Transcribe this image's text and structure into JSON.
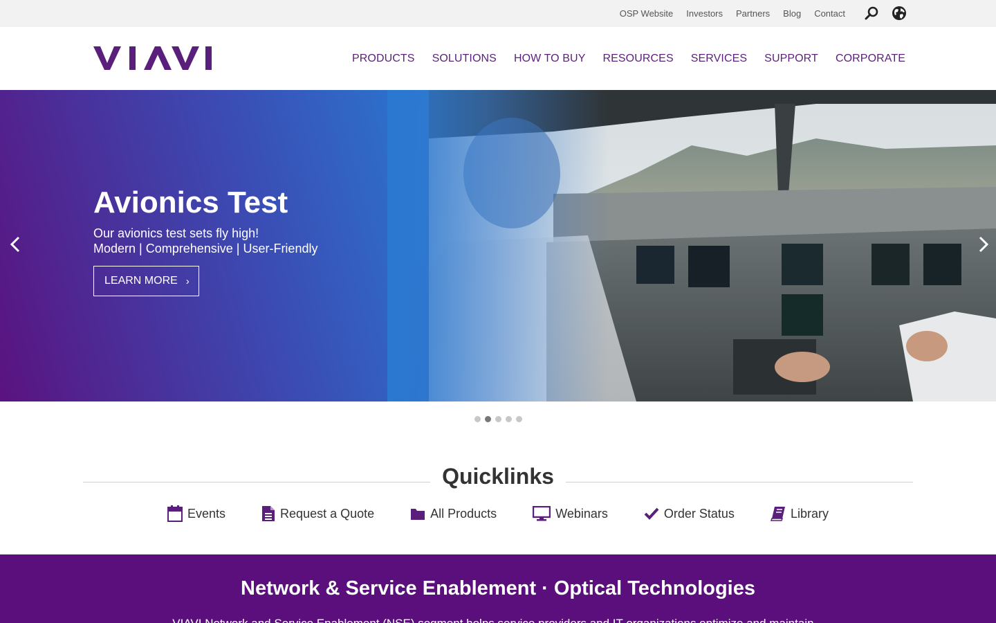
{
  "utility_nav": {
    "links": [
      "OSP Website",
      "Investors",
      "Partners",
      "Blog",
      "Contact"
    ],
    "icons": [
      "search-icon",
      "globe-icon"
    ]
  },
  "brand": {
    "logo_text": "VIAVI",
    "color": "#5a1f7a"
  },
  "main_nav": {
    "items": [
      "PRODUCTS",
      "SOLUTIONS",
      "HOW TO BUY",
      "RESOURCES",
      "SERVICES",
      "SUPPORT",
      "CORPORATE"
    ]
  },
  "hero": {
    "title": "Avionics Test",
    "subtitle_line1": "Our avionics test sets fly high!",
    "subtitle_line2": "Modern | Comprehensive | User-Friendly",
    "button_label": "LEARN MORE",
    "button_chevron": "›",
    "slide_count": 5,
    "active_slide": 2
  },
  "quicklinks": {
    "title": "Quicklinks",
    "items": [
      {
        "label": "Events",
        "icon": "calendar-icon"
      },
      {
        "label": "Request a Quote",
        "icon": "document-icon"
      },
      {
        "label": "All Products",
        "icon": "folder-icon"
      },
      {
        "label": "Webinars",
        "icon": "monitor-icon"
      },
      {
        "label": "Order Status",
        "icon": "checkmark-icon"
      },
      {
        "label": "Library",
        "icon": "book-icon"
      }
    ]
  },
  "band": {
    "title": "Network & Service Enablement · Optical Technologies",
    "body": "VIAVI Network and Service Enablement (NSE) segment helps service providers and IT organizations optimize and maintain...",
    "color": "#5a0f7c"
  }
}
